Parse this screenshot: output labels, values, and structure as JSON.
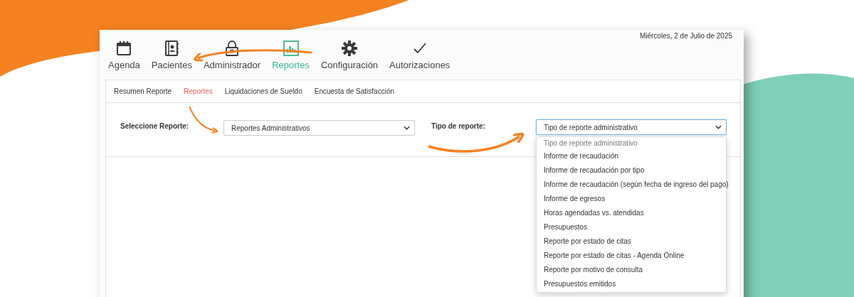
{
  "date": "Miércoles, 2 de Julio de 2025",
  "nav": [
    {
      "label": "Agenda",
      "kind": "calendar",
      "selected": false
    },
    {
      "label": "Pacientes",
      "kind": "contacts",
      "selected": false
    },
    {
      "label": "Administrador",
      "kind": "lock",
      "selected": false
    },
    {
      "label": "Reportes",
      "kind": "chart",
      "selected": true
    },
    {
      "label": "Configuración",
      "kind": "gear",
      "selected": false
    },
    {
      "label": "Autorizaciones",
      "kind": "check",
      "selected": false
    }
  ],
  "subtabs": [
    {
      "label": "Resumen Reporte",
      "selected": false
    },
    {
      "label": "Reportes",
      "selected": true
    },
    {
      "label": "Liquidaciones de Sueldo",
      "selected": false
    },
    {
      "label": "Encuesta de Satisfacción",
      "selected": false
    }
  ],
  "report_select": {
    "label": "Seleccione Reporte:",
    "value": "Reportes Administrativos"
  },
  "type_select": {
    "label": "Tipo de reporte:",
    "value": "Tipo de reporte administrativo",
    "expanded": true,
    "options": [
      {
        "label": "Tipo de reporte administrativo",
        "disabled": true
      },
      {
        "label": "Informe de recaudación",
        "disabled": false
      },
      {
        "label": "Informe de recaudación por tipo",
        "disabled": false
      },
      {
        "label": "Informe de recaudación (según fecha de ingreso del pago)",
        "disabled": false
      },
      {
        "label": "Informe de egresos",
        "disabled": false
      },
      {
        "label": "Horas agendadas vs. atendidas",
        "disabled": false
      },
      {
        "label": "Presupuestos",
        "disabled": false
      },
      {
        "label": "Reporte por estado de citas",
        "disabled": false
      },
      {
        "label": "Reporte por estado de citas - Agenda Online",
        "disabled": false
      },
      {
        "label": "Reporte por motivo de consulta",
        "disabled": false
      },
      {
        "label": "Presupuestos emitidos",
        "disabled": false
      }
    ]
  }
}
